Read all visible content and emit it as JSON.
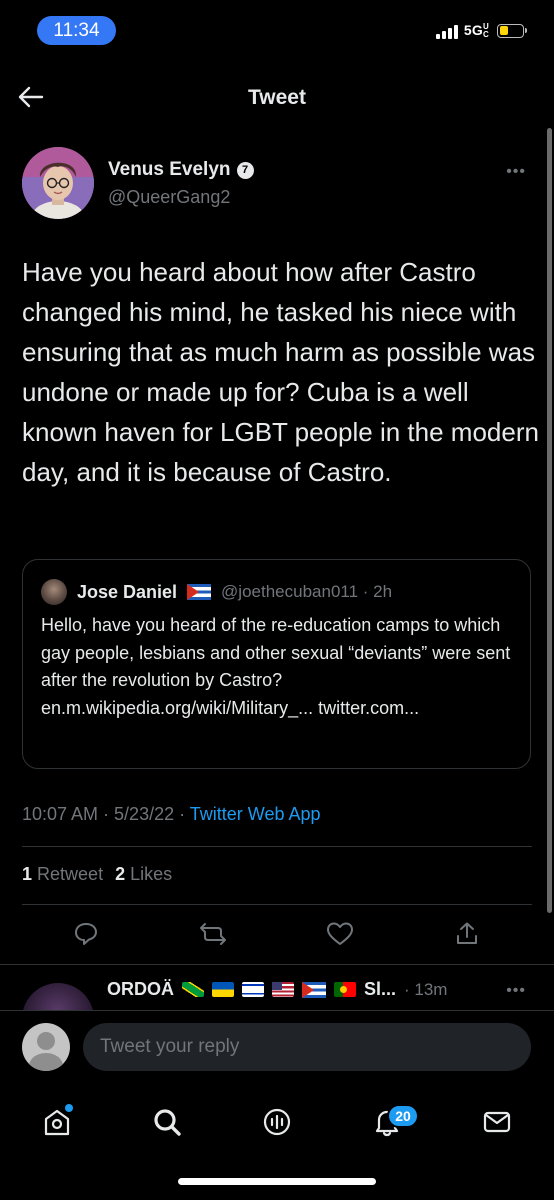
{
  "status_bar": {
    "time": "11:34",
    "network": "5G",
    "network_suffix": "UC"
  },
  "header": {
    "title": "Tweet",
    "back_icon": "arrow-left-icon"
  },
  "tweet": {
    "author_name": "Venus Evelyn",
    "author_badge_symbol": "7",
    "author_handle": "@QueerGang2",
    "more": "•••",
    "text": "Have you heard about how after Castro changed his mind, he tasked his niece with ensuring that as much harm as possible was undone or made up for? Cuba is a well known haven for LGBT people in the modern day, and it is because of Castro.",
    "quote": {
      "author_name": "Jose Daniel",
      "author_handle": "@joethecuban011 · 2h",
      "text": "Hello, have you heard of the re-education camps to which gay people, lesbians and other sexual “deviants” were sent after the revolution by Castro?",
      "links": "en.m.wikipedia.org/wiki/Military_... twitter.com..."
    },
    "timestamp": "10:07 AM · 5/23/22 · ",
    "source": "Twitter Web App",
    "retweet_count": "1",
    "retweet_label": "Retweet",
    "like_count": "2",
    "like_label": "Likes"
  },
  "next_tweet": {
    "author_name": "ORDOÄ",
    "author_suffix": "Sl...",
    "time": "· 13m",
    "more": "•••"
  },
  "reply": {
    "placeholder": "Tweet your reply"
  },
  "tab_bar": {
    "notifications_count": "20"
  },
  "colors": {
    "accent": "#1d9bf0",
    "background": "#000000",
    "text": "#e7e9ea",
    "secondary_text": "#71767b",
    "border": "#2f3336",
    "time_pill": "#3478f6",
    "battery": "#ffd60a"
  }
}
